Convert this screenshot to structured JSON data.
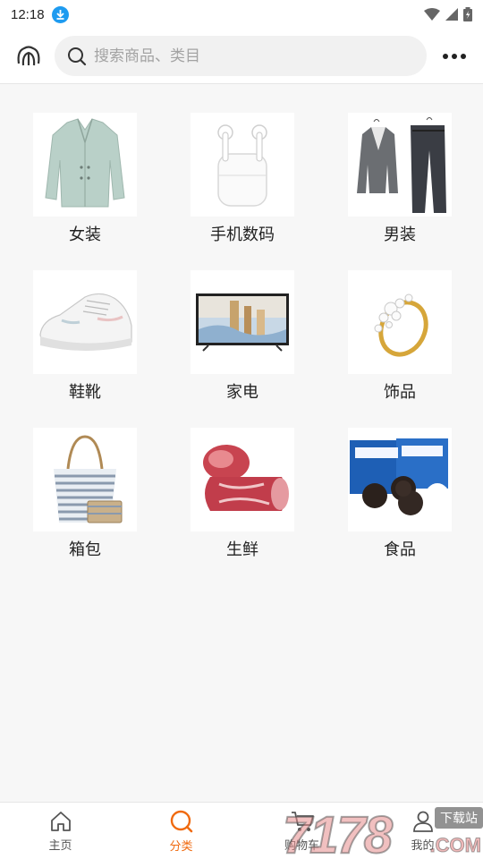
{
  "status_bar": {
    "time": "12:18"
  },
  "header": {
    "search_placeholder": "搜索商品、类目"
  },
  "categories": [
    {
      "label": "女装",
      "icon": "women-coat-image"
    },
    {
      "label": "手机数码",
      "icon": "earbuds-image"
    },
    {
      "label": "男装",
      "icon": "men-suit-image"
    },
    {
      "label": "鞋靴",
      "icon": "sneaker-image"
    },
    {
      "label": "家电",
      "icon": "tv-image"
    },
    {
      "label": "饰品",
      "icon": "ring-image"
    },
    {
      "label": "箱包",
      "icon": "tote-bag-image"
    },
    {
      "label": "生鲜",
      "icon": "meat-image"
    },
    {
      "label": "食品",
      "icon": "cookies-image"
    }
  ],
  "bottom_nav": {
    "items": [
      {
        "label": "主页",
        "icon": "home-icon"
      },
      {
        "label": "分类",
        "icon": "search-icon"
      },
      {
        "label": "购物车",
        "icon": "cart-icon"
      },
      {
        "label": "我的",
        "icon": "user-icon"
      }
    ],
    "active_index": 1,
    "active_color": "#f06a0f"
  },
  "watermark": {
    "number": "7178",
    "tag": "下载站",
    "domain": ".COM"
  }
}
